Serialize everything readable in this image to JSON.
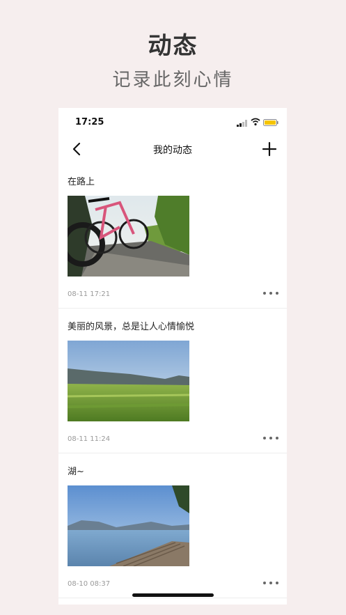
{
  "hero": {
    "title": "动态",
    "subtitle": "记录此刻心情"
  },
  "status_bar": {
    "time": "17:25"
  },
  "nav": {
    "title": "我的动态"
  },
  "posts": [
    {
      "text": "在路上",
      "time": "08-11 17:21",
      "image": "bicycle-road-photo"
    },
    {
      "text": "美丽的风景，总是让人心情愉悦",
      "time": "08-11 11:24",
      "image": "grassland-mountains-photo"
    },
    {
      "text": "湖~",
      "time": "08-10 08:37",
      "image": "lake-pier-photo"
    }
  ],
  "icons": [
    "signal-icon",
    "wifi-icon",
    "battery-icon",
    "back-icon",
    "add-icon",
    "more-icon"
  ],
  "colors": {
    "background": "#f6eeee",
    "battery": "#f5c400"
  }
}
